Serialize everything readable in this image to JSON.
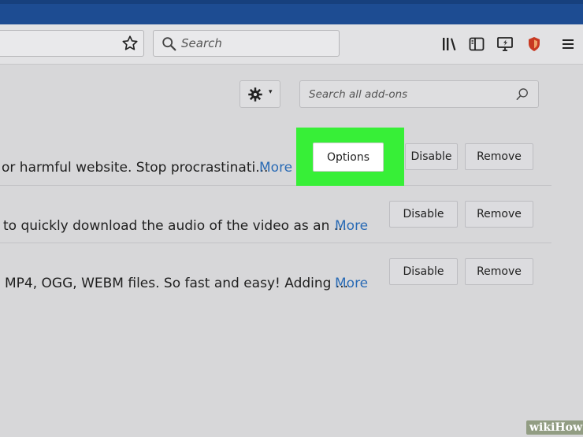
{
  "toolbar": {
    "search_placeholder": "Search"
  },
  "addons_page": {
    "search_placeholder": "Search all add-ons"
  },
  "addons": [
    {
      "description": "or harmful website. Stop procrastinati...",
      "more_label": "More",
      "options_label": "Options",
      "disable_label": "Disable",
      "remove_label": "Remove"
    },
    {
      "description": "to quickly download the audio of the video as an ...",
      "more_label": "More",
      "disable_label": "Disable",
      "remove_label": "Remove"
    },
    {
      "description": "MP4, OGG, WEBM files. So fast and easy! Adding ...",
      "more_label": "More",
      "disable_label": "Disable",
      "remove_label": "Remove"
    }
  ],
  "colors": {
    "highlight": "#37ef37",
    "link": "#2a6bb5",
    "titlebar": "#1d4c92"
  },
  "watermark": {
    "prefix": "wiki",
    "suffix": "How"
  }
}
